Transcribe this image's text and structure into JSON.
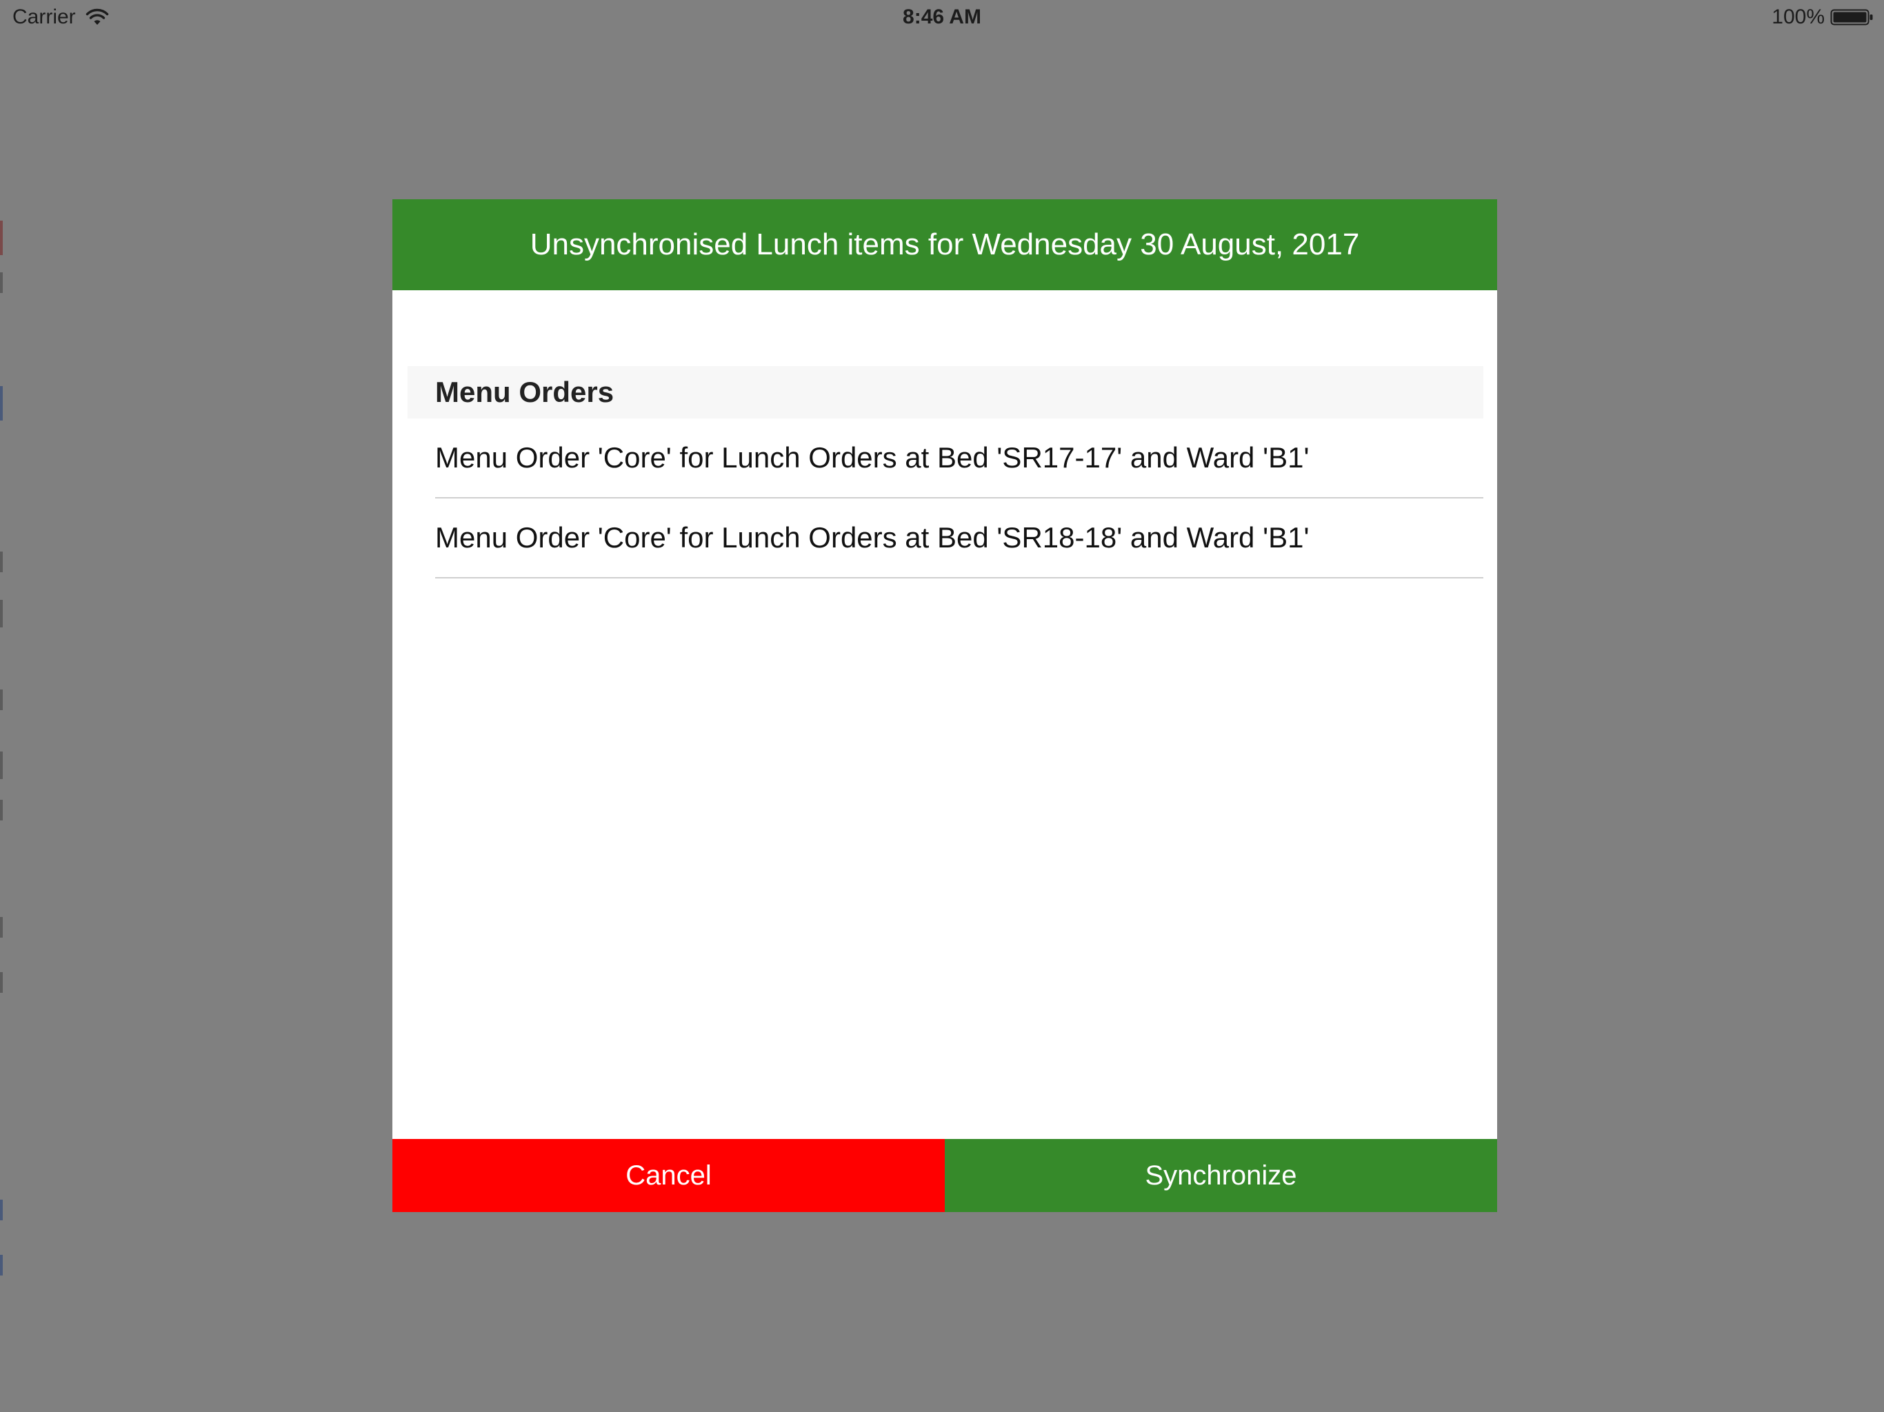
{
  "status_bar": {
    "carrier": "Carrier",
    "time": "8:46 AM",
    "battery_percent": "100%",
    "wifi_icon": "wifi-icon",
    "battery_icon": "battery-icon"
  },
  "modal": {
    "title": "Unsynchronised Lunch items for Wednesday 30 August, 2017",
    "section_title": "Menu Orders",
    "items": [
      {
        "label": "Menu Order 'Core' for Lunch Orders at Bed 'SR17-17' and Ward 'B1'"
      },
      {
        "label": "Menu Order 'Core' for Lunch Orders at Bed 'SR18-18' and Ward 'B1'"
      }
    ],
    "cancel_label": "Cancel",
    "synchronize_label": "Synchronize"
  },
  "colors": {
    "overlay": "#808080",
    "header_green": "#368a2a",
    "cancel_red": "#ff0000",
    "synchronize_green": "#368a2a"
  }
}
